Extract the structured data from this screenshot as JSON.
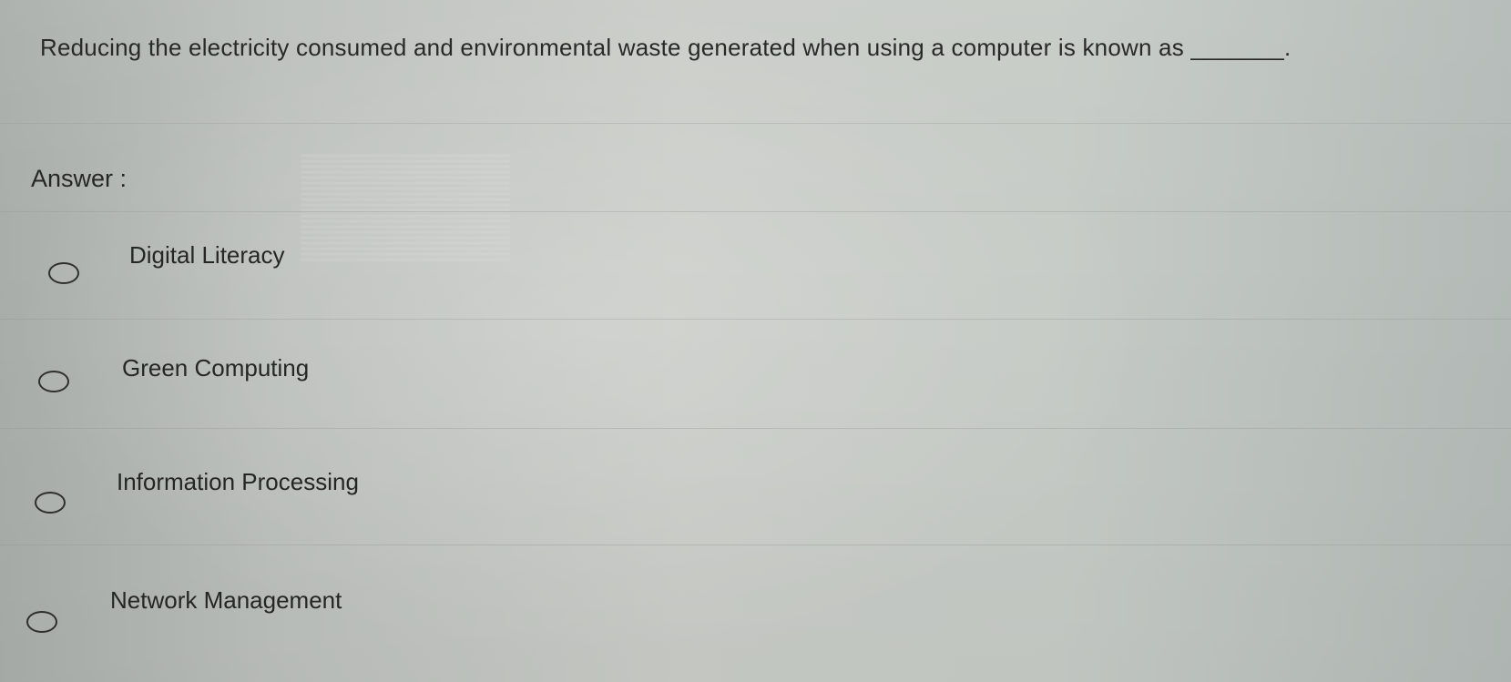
{
  "question": {
    "text": "Reducing the electricity consumed and environmental waste generated when using a computer is known as _______."
  },
  "answer": {
    "label": "Answer :"
  },
  "options": [
    {
      "label": "Digital Literacy",
      "selected": false
    },
    {
      "label": "Green Computing",
      "selected": false
    },
    {
      "label": "Information Processing",
      "selected": false
    },
    {
      "label": "Network Management",
      "selected": false
    }
  ],
  "colors": {
    "text": "#202020",
    "radio_border": "#2f2f2f"
  }
}
